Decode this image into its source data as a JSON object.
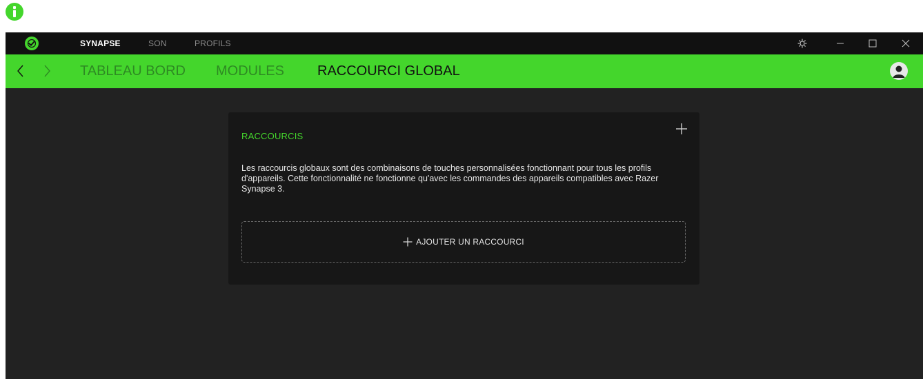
{
  "titlebar": {
    "tabs": [
      {
        "label": "SYNAPSE"
      },
      {
        "label": "SON"
      },
      {
        "label": "PROFILS"
      }
    ]
  },
  "subnav": {
    "tabs": [
      {
        "label": "TABLEAU BORD"
      },
      {
        "label": "MODULES"
      },
      {
        "label": "RACCOURCI GLOBAL"
      }
    ]
  },
  "card": {
    "title": "RACCOURCIS",
    "description": "Les raccourcis globaux sont des combinaisons de touches personnalisées fonctionnant pour tous les profils d'appareils. Cette fonctionnalité ne fonctionne qu'avec les commandes des appareils compatibles avec Razer Synapse 3.",
    "add_button_label": "AJOUTER UN RACCOURCI"
  },
  "colors": {
    "accent": "#44d62c",
    "background": "#222222",
    "card": "#171717",
    "titlebar": "#111111"
  },
  "icons": {
    "info": "info-icon",
    "logo": "razer-logo-icon",
    "settings": "gear-icon",
    "minimize": "minimize-icon",
    "maximize": "maximize-icon",
    "close": "close-icon",
    "back": "chevron-left-icon",
    "forward": "chevron-right-icon",
    "user": "user-avatar-icon",
    "add": "plus-icon"
  }
}
